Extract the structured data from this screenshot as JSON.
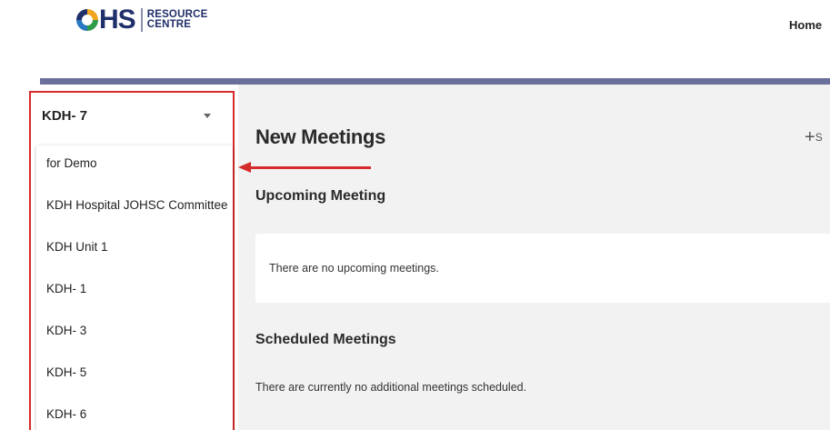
{
  "header": {
    "logo_main": "HS",
    "logo_line1": "RESOURCE",
    "logo_line2": "CENTRE",
    "nav": {
      "home": "Home"
    }
  },
  "sidebar": {
    "selected_committee": "KDH- 7",
    "options": [
      "for Demo",
      "KDH Hospital JOHSC Committee",
      "KDH Unit 1",
      "KDH- 1",
      "KDH- 3",
      "KDH- 5",
      "KDH- 6"
    ]
  },
  "main": {
    "title": "New Meetings",
    "add_button_label": "S",
    "upcoming": {
      "title": "Upcoming Meeting",
      "empty_text": "There are no upcoming meetings."
    },
    "scheduled": {
      "title": "Scheduled Meetings",
      "empty_text": "There are currently no additional meetings scheduled."
    }
  },
  "colors": {
    "brand_navy": "#1f2f6a",
    "header_bar": "#6b6f9b",
    "highlight_red": "#d62b2b",
    "main_background": "#f2f2f2"
  }
}
